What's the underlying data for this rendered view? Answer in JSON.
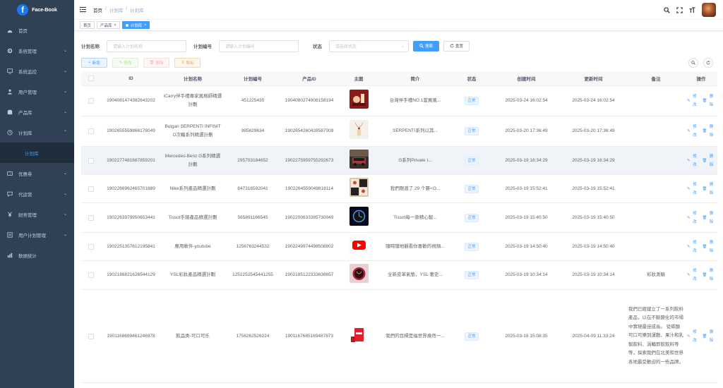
{
  "brand": {
    "name": "Face-Book",
    "logo_letter": "f",
    "color": "#1877f2"
  },
  "sidebar": {
    "items": [
      {
        "label": "首页",
        "icon": "dashboard-icon",
        "arrow": false
      },
      {
        "label": "系统管理",
        "icon": "gear-icon",
        "arrow": true
      },
      {
        "label": "系统监控",
        "icon": "monitor-icon",
        "arrow": true
      },
      {
        "label": "用户管理",
        "icon": "user-icon",
        "arrow": true
      },
      {
        "label": "产品库",
        "icon": "box-icon",
        "arrow": true
      },
      {
        "label": "计划库",
        "icon": "clock-icon",
        "arrow": true,
        "expanded": true
      },
      {
        "label": "优惠券",
        "icon": "ticket-icon",
        "arrow": true
      },
      {
        "label": "代运营",
        "icon": "chat-icon",
        "arrow": true
      },
      {
        "label": "财务管理",
        "icon": "yen-icon",
        "arrow": true
      },
      {
        "label": "用户计划管理",
        "icon": "people-icon",
        "arrow": true
      },
      {
        "label": "数据统计",
        "icon": "chart-icon",
        "arrow": false
      }
    ],
    "sub_active": "计划库"
  },
  "header": {
    "breadcrumb": [
      "首页",
      "/",
      "计划库",
      "/",
      "计划库"
    ]
  },
  "tags": [
    {
      "label": "首页",
      "active": false,
      "closable": false
    },
    {
      "label": "产品库",
      "active": false,
      "closable": true
    },
    {
      "label": "计划库",
      "active": true,
      "closable": true
    }
  ],
  "search": {
    "name_label": "计划名称",
    "name_placeholder": "请输入计划名称",
    "code_label": "计划编号",
    "code_placeholder": "请输入计划编号",
    "status_label": "状态",
    "status_placeholder": "请选择状态",
    "search_btn": "搜索",
    "reset_btn": "重置"
  },
  "toolbar": {
    "add": "新增",
    "edit": "修改",
    "delete": "删除",
    "export": "导出"
  },
  "table": {
    "columns": [
      "ID",
      "计划名称",
      "计划编号",
      "产品ID",
      "主图",
      "简介",
      "状态",
      "创建时间",
      "更新时间",
      "备注",
      "操作"
    ],
    "edit_label": "修改",
    "delete_label": "删除",
    "rows": [
      {
        "id": "1904081474382643202",
        "name": "iCarry伴手禮專家風格師精選計劃",
        "code": "451225435",
        "pid": "1904080274908158194",
        "img": "lipstick",
        "intro": "台灣伴手禮NO.1當買風...",
        "status": "正常",
        "created": "2025-03-24 16:02:54",
        "updated": "2025-03-24 16:02:54",
        "remark": "",
        "h": 43
      },
      {
        "id": "1902655559866178049",
        "name": "Bulgari SERPENTI INFINITO次輪系列精選計劃",
        "code": "985629634",
        "pid": "1902654260428587009",
        "img": "necklace",
        "intro": "SERPENTI系列以其...",
        "status": "正常",
        "created": "2025-03-20 17:36:49",
        "updated": "2025-03-20 17:36:49",
        "remark": "",
        "h": 43
      },
      {
        "id": "1902277481687859201",
        "name": "Mercedes-Benz G系列精選計劃",
        "code": "295703184652",
        "pid": "1902275959755292673",
        "img": "car",
        "intro": "G系列Private I...",
        "status": "正常",
        "created": "2025-03-19 16:34:29",
        "updated": "2025-03-19 16:34:29",
        "remark": "",
        "h": 40,
        "hl": true
      },
      {
        "id": "1902266962465701889",
        "name": "Nike系列產品精選計劃",
        "code": "847316592041",
        "pid": "1902264559049818114",
        "img": "nike",
        "intro": "我們剛渡了 29 个賽<O...",
        "status": "正常",
        "created": "2025-03-19 15:52:41",
        "updated": "2025-03-19 15:52:41",
        "remark": "",
        "h": 40
      },
      {
        "id": "1902263979950653441",
        "name": "Tissot手錶產品精選計劃",
        "code": "565891166545",
        "pid": "1902200633385730049",
        "img": "watch",
        "intro": "Tissot每一款精心製...",
        "status": "正常",
        "created": "2025-03-19 15:40:50",
        "updated": "2025-03-19 15:40:50",
        "remark": "",
        "h": 42
      },
      {
        "id": "1902251357612195841",
        "name": "應用軟件-youtube",
        "code": "1256763244532",
        "pid": "1902249974498508802",
        "img": "youtube",
        "intro": "隨時隨地觀看你喜歡的視頻...",
        "status": "正常",
        "created": "2025-03-19 14:50:40",
        "updated": "2025-03-19 14:50:40",
        "remark": "",
        "h": 40
      },
      {
        "id": "1902186821626544129",
        "name": "YSL彩妝產品精選計劃",
        "code": "1251252545441255",
        "pid": "1902185122333638657",
        "img": "ysl",
        "intro": "全新皮革氣墊，YSL 奢史...",
        "status": "正常",
        "created": "2025-03-19 10:34:14",
        "updated": "2025-03-19 10:34:14",
        "remark": "彩妝測驗",
        "h": 41
      },
      {
        "id": "1901168699461246978",
        "name": "飲品类-可口可乐",
        "code": "1756262526224",
        "pid": "1901167685169487873",
        "img": "coke",
        "intro": "我們的目標是福世界煥然一...",
        "status": "正常",
        "created": "2025-03-16 15:08:35",
        "updated": "2025-04-09 11:33:24",
        "remark": "我們已經建立了一系列飲料產品，以在不斷變化的市場中實現最佳成長。 從碳酸可口可樂到運動、果汁和乳製飲料、涡輪即飲飲料等等，探索我們在北美和世界各地最受歡迎的一些品牌。",
        "h": 132,
        "long": true
      }
    ]
  },
  "colors": {
    "sidebar_bg": "#304156",
    "primary": "#409eff"
  }
}
